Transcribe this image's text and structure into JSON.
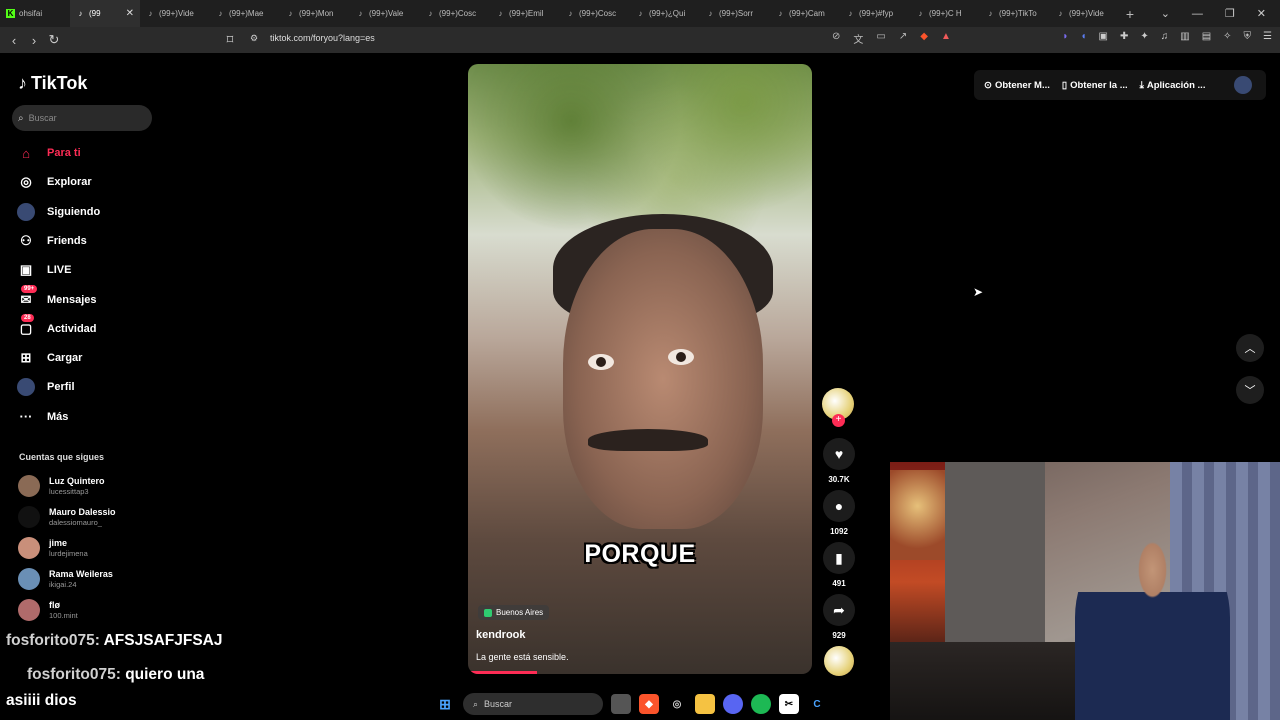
{
  "browser": {
    "tabs": [
      {
        "label": "ohsifai",
        "icon": "k-icon"
      },
      {
        "label": "(99",
        "icon": "tiktok-icon",
        "active": true
      },
      {
        "label": "(99+)Vide",
        "icon": "tiktok-icon"
      },
      {
        "label": "(99+)Mae",
        "icon": "tiktok-icon"
      },
      {
        "label": "(99+)Mon",
        "icon": "tiktok-icon"
      },
      {
        "label": "(99+)Vale",
        "icon": "tiktok-icon"
      },
      {
        "label": "(99+)Cosc",
        "icon": "tiktok-icon"
      },
      {
        "label": "(99+)Emil",
        "icon": "tiktok-icon"
      },
      {
        "label": "(99+)Cosc",
        "icon": "tiktok-icon"
      },
      {
        "label": "(99+)¿Qui",
        "icon": "tiktok-icon"
      },
      {
        "label": "(99+)Sorr",
        "icon": "tiktok-icon"
      },
      {
        "label": "(99+)Cam",
        "icon": "tiktok-icon"
      },
      {
        "label": "(99+)#fyp",
        "icon": "tiktok-icon"
      },
      {
        "label": "(99+)C H",
        "icon": "tiktok-icon"
      },
      {
        "label": "(99+)TikTo",
        "icon": "tiktok-icon"
      },
      {
        "label": "(99+)Vide",
        "icon": "tiktok-icon"
      }
    ],
    "url": "tiktok.com/foryou?lang=es"
  },
  "sidebar": {
    "logo": "TikTok",
    "search_placeholder": "Buscar",
    "items": [
      {
        "label": "Para ti",
        "icon": "home-icon",
        "active": true
      },
      {
        "label": "Explorar",
        "icon": "compass-icon"
      },
      {
        "label": "Siguiendo",
        "icon": "following-avatar-icon"
      },
      {
        "label": "Friends",
        "icon": "friends-icon"
      },
      {
        "label": "LIVE",
        "icon": "live-icon"
      },
      {
        "label": "Mensajes",
        "icon": "message-icon",
        "badge": "99+"
      },
      {
        "label": "Actividad",
        "icon": "activity-icon",
        "badge": "28"
      },
      {
        "label": "Cargar",
        "icon": "upload-icon"
      },
      {
        "label": "Perfil",
        "icon": "profile-icon"
      },
      {
        "label": "Más",
        "icon": "more-icon"
      }
    ],
    "following_title": "Cuentas que sigues",
    "following": [
      {
        "name": "Luz Quintero",
        "handle": "lucessittap3",
        "color": "#8a6a55"
      },
      {
        "name": "Mauro Dalessio",
        "handle": "dalessiomauro_",
        "color": "#111111"
      },
      {
        "name": "jime",
        "handle": "lurdejimena",
        "color": "#c98f7a"
      },
      {
        "name": "Rama Weileras",
        "handle": "ikigai.24",
        "color": "#6a8fb5"
      },
      {
        "name": "flø",
        "handle": "100.mint",
        "color": "#b06b6b"
      }
    ]
  },
  "video": {
    "caption_overlay": "PORQUE",
    "location": "Buenos Aires",
    "author": "kendrook",
    "description": "La gente está sensible.",
    "progress": 0.2
  },
  "actions": {
    "likes": "30.7K",
    "comments": "1092",
    "saves": "491",
    "shares": "929"
  },
  "top_right": {
    "items": [
      "Obtener M...",
      "Obtener la ...",
      "Aplicación ..."
    ]
  },
  "chat": [
    {
      "user": "fosforito075:",
      "msg": "AFSJSAFJFSAJ"
    },
    {
      "user": "fosforito075:",
      "msg": "quiero una"
    },
    {
      "user": "",
      "msg": "asiiii dios"
    }
  ],
  "taskbar": {
    "search_placeholder": "Buscar"
  }
}
